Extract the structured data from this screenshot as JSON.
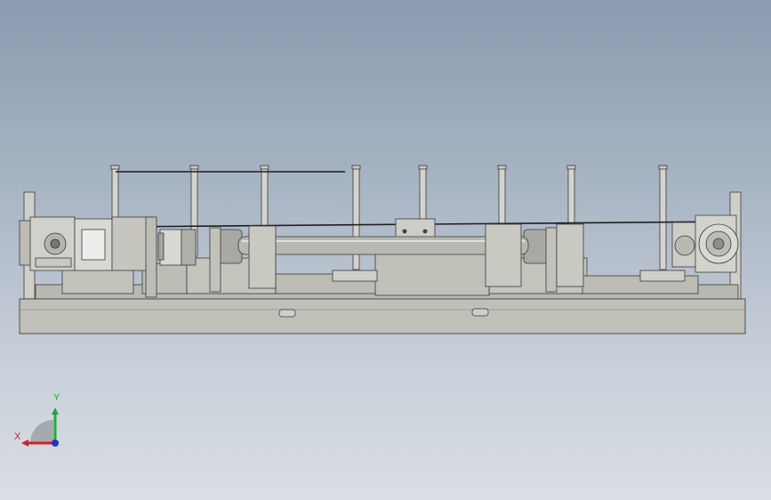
{
  "viewport": {
    "background_top": "#8a9bb0",
    "background_bottom": "#d9dee4",
    "model": "machine-assembly",
    "view": "front"
  },
  "triad": {
    "x_label": "X",
    "y_label": "Y",
    "colors": {
      "x": "#d02020",
      "y": "#22aa33",
      "z": "#2030d0"
    }
  }
}
